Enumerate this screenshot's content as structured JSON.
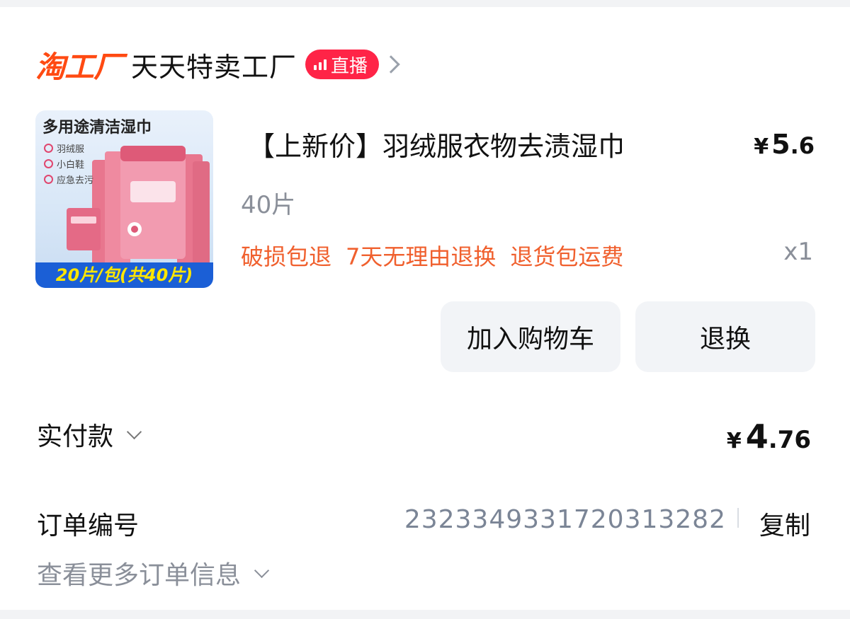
{
  "shop": {
    "brand": "淘工厂",
    "name": "天天特卖工厂",
    "live_label": "直播",
    "brand_color": "#ff4a12",
    "live_color": "#ff2447"
  },
  "product": {
    "image": {
      "title": "多用途清洁湿巾",
      "features": [
        "羽绒服",
        "小白鞋",
        "应急去污"
      ],
      "footer": "20片/包(共40片)"
    },
    "title": "【上新价】羽绒服衣物去渍湿巾",
    "price": {
      "currency": "¥",
      "integer": "5",
      "decimal": ".6"
    },
    "variant": "40片",
    "services": [
      "破损包退",
      "7天无理由退换",
      "退货包运费"
    ],
    "quantity": "x1",
    "service_color": "#f0602e"
  },
  "actions": {
    "add_to_cart": "加入购物车",
    "return_exchange": "退换"
  },
  "payment": {
    "label": "实付款",
    "currency": "¥",
    "integer": "4",
    "decimal": ".76"
  },
  "order": {
    "label": "订单编号",
    "number": "2323349331720313282",
    "copy_label": "复制",
    "more_info_label": "查看更多订单信息"
  },
  "icons": [
    "chevron-right-icon",
    "live-bars-icon",
    "chevron-down-icon",
    "check-circle-icon"
  ]
}
